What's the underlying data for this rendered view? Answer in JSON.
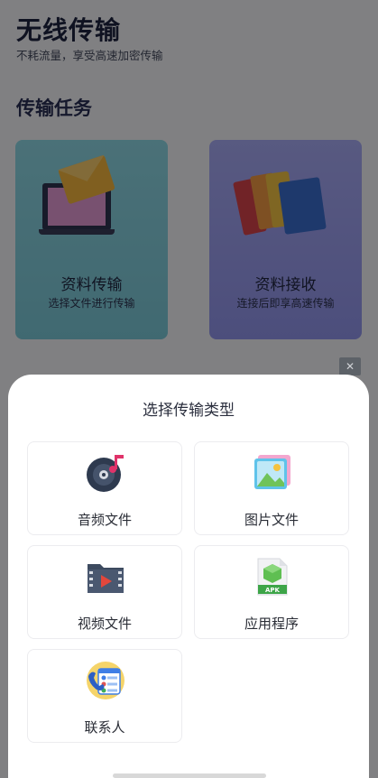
{
  "app": {
    "title": "无线传输",
    "subtitle": "不耗流量，享受高速加密传输"
  },
  "section": {
    "title": "传输任务"
  },
  "cards": [
    {
      "title": "资料传输",
      "subtitle": "选择文件进行传输",
      "color": "#7ccad9"
    },
    {
      "title": "资料接收",
      "subtitle": "连接后即享高速传输",
      "color": "#9396ee"
    }
  ],
  "sheet": {
    "title": "选择传输类型",
    "options": [
      {
        "label": "音频文件",
        "icon": "audio-disc-icon"
      },
      {
        "label": "图片文件",
        "icon": "picture-icon"
      },
      {
        "label": "视频文件",
        "icon": "video-folder-icon"
      },
      {
        "label": "应用程序",
        "icon": "apk-icon",
        "badge": "APK"
      },
      {
        "label": "联系人",
        "icon": "contacts-icon"
      }
    ]
  },
  "colors": {
    "accent_send": "#7ccad9",
    "accent_receive": "#9396ee",
    "overlay": "rgba(0,0,0,0.48)"
  }
}
